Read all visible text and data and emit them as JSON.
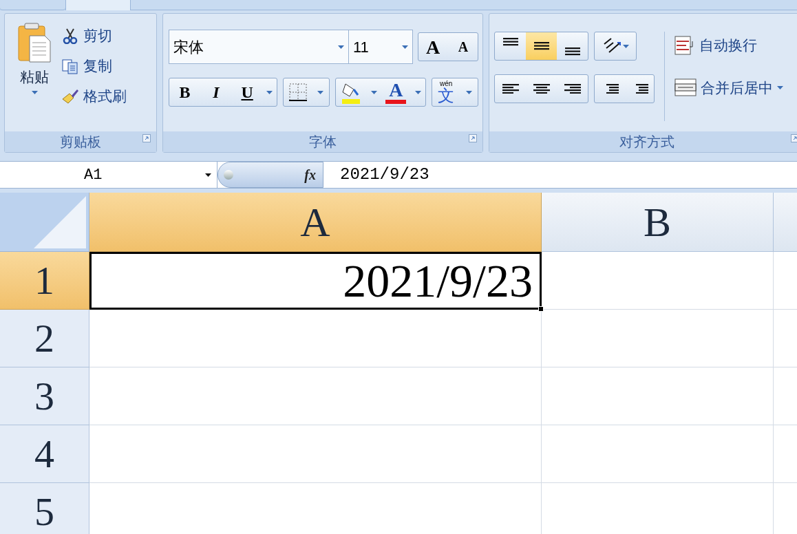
{
  "clipboard": {
    "paste": "粘贴",
    "cut": "剪切",
    "copy": "复制",
    "format_painter": "格式刷",
    "group_label": "剪贴板"
  },
  "font": {
    "name": "宋体",
    "size": "11",
    "grow": "A",
    "shrink": "A",
    "bold": "B",
    "italic": "I",
    "underline": "U",
    "font_color": "A",
    "phonetic_top": "wén",
    "phonetic": "文",
    "group_label": "字体"
  },
  "alignment": {
    "vertical": [
      {
        "selected": false
      },
      {
        "selected": true
      },
      {
        "selected": false
      }
    ],
    "wrap_text": "自动换行",
    "merge_center": "合并后居中",
    "group_label": "对齐方式"
  },
  "formula_bar": {
    "name_box": "A1",
    "fx": "fx",
    "value": "2021/9/23"
  },
  "sheet": {
    "columns": [
      {
        "label": "A",
        "selected": true
      },
      {
        "label": "B",
        "selected": false
      }
    ],
    "rows": [
      {
        "label": "1",
        "selected": true,
        "value": "2021/9/23"
      },
      {
        "label": "2",
        "selected": false
      },
      {
        "label": "3",
        "selected": false
      },
      {
        "label": "4",
        "selected": false
      },
      {
        "label": "5",
        "selected": false
      }
    ]
  }
}
